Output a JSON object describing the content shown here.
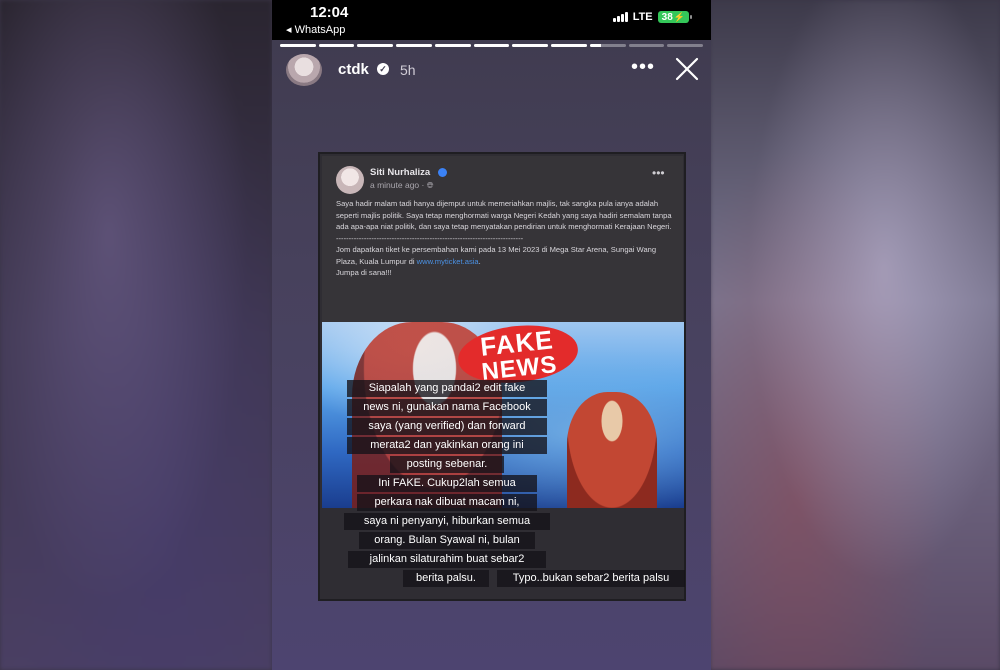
{
  "status_bar": {
    "time": "12:04",
    "back_app": "◂ WhatsApp",
    "network": "LTE",
    "battery": "38"
  },
  "progress": {
    "segments": [
      1,
      1,
      1,
      1,
      1,
      1,
      1,
      1,
      0.3,
      0,
      0
    ]
  },
  "story": {
    "username": "ctdk",
    "age": "5h",
    "verified_icon": "✓",
    "more_icon": "•••"
  },
  "post": {
    "author": "Siti Nurhaliza",
    "time": "a minute ago · ",
    "more": "•••",
    "paragraph1": "Saya hadir malam tadi hanya dijemput untuk memeriahkan majlis, tak sangka pula ianya adalah seperti majlis politik. Saya tetap menghormati warga Negeri Kedah yang saya hadiri semalam tanpa ada apa-apa niat politik, dan saya tetap menyatakan pendirian untuk menghormati Kerajaan Negeri.",
    "divider": "--------------------------------------------------------------------------",
    "paragraph2": "Jom dapatkan tiket ke persembahan kami pada 13 Mei 2023 di Mega Star Arena, Sungai Wang Plaza, Kuala Lumpur di ",
    "link": "www.myticket.asia",
    "paragraph2_end": ".",
    "sign_off": "Jumpa di sana!!!",
    "stamp_line1": "FAKE",
    "stamp_line2": "NEWS"
  },
  "captions": [
    "Siapalah yang pandai2 edit fake",
    "news ni, gunakan nama Facebook",
    "saya (yang verified) dan forward",
    "merata2 dan yakinkan orang ini",
    "posting sebenar.",
    "Ini FAKE. Cukup2lah semua",
    "perkara nak dibuat macam ni,",
    "saya ni penyanyi, hiburkan semua",
    "orang. Bulan Syawal ni, bulan",
    "jalinkan silaturahim buat sebar2",
    "berita palsu.",
    "Typo..bukan sebar2 berita palsu"
  ]
}
